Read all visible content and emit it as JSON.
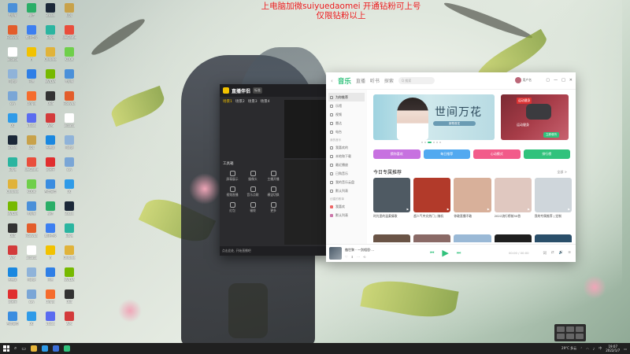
{
  "banner": {
    "line1": "上电脑加微suiyuedaomei 开通钻粉可上号",
    "line2": "仅限钻粉以上"
  },
  "desktop_icons": [
    {
      "label": "此电脑",
      "color": "#4a90d9"
    },
    {
      "label": "Fibovaa",
      "color": "#e35d2b"
    },
    {
      "label": "alibaba",
      "color": "#ffffff"
    },
    {
      "label": "回收站",
      "color": "#8fb3d9"
    },
    {
      "label": "xxy",
      "color": "#7aa6d6"
    },
    {
      "label": "QQ",
      "color": "#2f9be8"
    },
    {
      "label": "Steam",
      "color": "#1b2838"
    },
    {
      "label": "Edge",
      "color": "#2bb5a0"
    },
    {
      "label": "Chrome",
      "color": "#e0b33a"
    },
    {
      "label": "NVIDIA",
      "color": "#76b900"
    },
    {
      "label": "OBS",
      "color": "#333333"
    },
    {
      "label": "WPS",
      "color": "#d33b3b"
    },
    {
      "label": "直播姬",
      "color": "#1a88e0"
    },
    {
      "label": "网易云",
      "color": "#e02f2f"
    },
    {
      "label": "百度网盘",
      "color": "#3a8de0"
    },
    {
      "label": "微信",
      "color": "#2aae67"
    },
    {
      "label": "腾讯会议",
      "color": "#3c7ff0"
    },
    {
      "label": "YY",
      "color": "#f2c200"
    },
    {
      "label": "迅雷",
      "color": "#2f7fe6"
    },
    {
      "label": "Origin",
      "color": "#f56c2d"
    },
    {
      "label": "uTools",
      "color": "#5a6cf0"
    },
    {
      "label": "LOL",
      "color": "#c8a24a"
    },
    {
      "label": "WeGame",
      "color": "#e94e3c"
    },
    {
      "label": "KOOK",
      "color": "#6fcf4a"
    }
  ],
  "dark_app": {
    "title": "直播伴侣",
    "tag": "标准",
    "tabs": [
      "场景1",
      "场景2",
      "场景3",
      "场景4"
    ],
    "side_label": "工具箱",
    "tools": [
      {
        "label": "屏幕展示"
      },
      {
        "label": "摄像头"
      },
      {
        "label": "主播开播"
      },
      {
        "label": "视频直播"
      },
      {
        "label": "音乐点歌"
      },
      {
        "label": "横竖切换"
      },
      {
        "label": "红包"
      },
      {
        "label": "福袋"
      },
      {
        "label": "更多"
      }
    ],
    "footer": "点击此处, 开始直播吧"
  },
  "music": {
    "back": "‹",
    "tabs": [
      {
        "label": "音乐",
        "active": true
      },
      {
        "label": "直播",
        "active": false
      },
      {
        "label": "听书",
        "active": false
      },
      {
        "label": "探索",
        "active": false
      }
    ],
    "search_placeholder": "Q 搜索",
    "user_name": "用户名",
    "sidebar": {
      "items": [
        {
          "label": "为你推荐",
          "active": true
        },
        {
          "label": "乐馆",
          "active": false
        },
        {
          "label": "视频",
          "active": false
        },
        {
          "label": "雷达",
          "active": false
        },
        {
          "label": "电台",
          "active": false
        }
      ],
      "my_music_head": "我的音乐",
      "my_music": [
        {
          "label": "我喜欢的"
        },
        {
          "label": "本地和下载"
        },
        {
          "label": "最近播放"
        },
        {
          "label": "已购音乐"
        },
        {
          "label": "我的音乐云盘"
        },
        {
          "label": "默认列表"
        }
      ],
      "playlist_head": "创建的歌单",
      "playlists": [
        {
          "label": "我喜欢"
        },
        {
          "label": "默认列表"
        }
      ]
    },
    "banner": {
      "title": "世间万花",
      "subtitle": "新歌首发"
    },
    "banner2": {
      "label": "运动健身",
      "text": "运动健身",
      "btn": "立即收听"
    },
    "pills": [
      {
        "label": "猜你喜欢",
        "color": "#c771e0"
      },
      {
        "label": "每日推荐",
        "color": "#52a9f0"
      },
      {
        "label": "心动模式",
        "color": "#f25b8a"
      },
      {
        "label": "排行榜",
        "color": "#31c27c"
      }
    ],
    "section_title": "今日专属推荐",
    "section_more": "全部 >",
    "cards": [
      {
        "caption": "时光里的温柔情歌",
        "color": "#4f5a63"
      },
      {
        "caption": "超人气中文热门 | 随机",
        "color": "#b23a2a"
      },
      {
        "caption": "你敢直播不敢",
        "color": "#d8b09a"
      },
      {
        "caption": "2022流行榜前50首",
        "color": "#e0c8c0"
      },
      {
        "caption": "我的专属推荐 | 定制",
        "color": "#cfd6db"
      }
    ],
    "row2": [
      {
        "color": "#6a5446"
      },
      {
        "color": "#8a6a66"
      },
      {
        "color": "#9ab9d6"
      },
      {
        "color": "#1f1f1f"
      },
      {
        "color": "#2a4f6a"
      }
    ],
    "player": {
      "title": "傲世黎 - 一剑相思·…",
      "time": "00:00 / 00:00",
      "prev": "⏮",
      "play": "▶",
      "next": "⏭",
      "icons": [
        "♡",
        "⬇",
        "⋯",
        "⟲"
      ],
      "right": [
        "词",
        "⇄",
        "🔊",
        "≡"
      ]
    },
    "win_buttons": [
      "▢",
      "—",
      "□",
      "✕"
    ]
  },
  "taskbar": {
    "weather": "29°C 多云",
    "time": "19:07",
    "date": "2022/1/7",
    "apps": [
      {
        "color": "#e8b63a"
      },
      {
        "color": "#2f9be8"
      },
      {
        "color": "#3b6fd8"
      },
      {
        "color": "#31c27c"
      }
    ]
  }
}
